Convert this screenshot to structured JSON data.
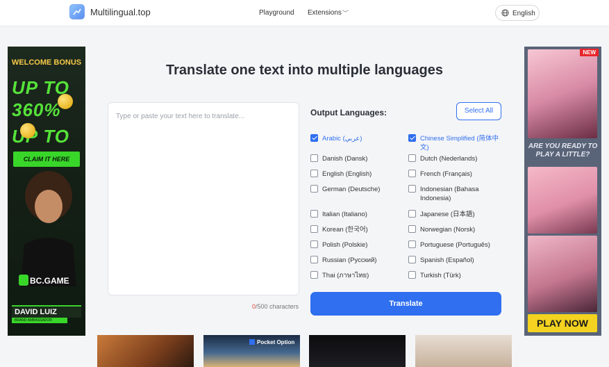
{
  "header": {
    "brand": "Multilingual.top",
    "nav": {
      "playground": "Playground",
      "extensions": "Extensions"
    },
    "language_button": "English"
  },
  "main": {
    "title": "Translate one text into multiple languages",
    "input_placeholder": "Type or paste your text here to translate...",
    "counter": {
      "count": "0",
      "suffix": "/500 characters"
    },
    "output_label": "Output Languages:",
    "select_all": "Select All",
    "translate_button": "Translate",
    "languages": [
      {
        "label": "Arabic (عربي)",
        "checked": true
      },
      {
        "label": "Chinese Simplified (简体中文)",
        "checked": true
      },
      {
        "label": "Danish (Dansk)",
        "checked": false
      },
      {
        "label": "Dutch (Nederlands)",
        "checked": false
      },
      {
        "label": "English (English)",
        "checked": false
      },
      {
        "label": "French (Français)",
        "checked": false
      },
      {
        "label": "German (Deutsche)",
        "checked": false
      },
      {
        "label": "Indonesian (Bahasa Indonesia)",
        "checked": false
      },
      {
        "label": "Italian (Italiano)",
        "checked": false
      },
      {
        "label": "Japanese (日本語)",
        "checked": false
      },
      {
        "label": "Korean (한국어)",
        "checked": false
      },
      {
        "label": "Norwegian (Norsk)",
        "checked": false
      },
      {
        "label": "Polish (Polskie)",
        "checked": false
      },
      {
        "label": "Portuguese (Português)",
        "checked": false
      },
      {
        "label": "Russian (Русский)",
        "checked": false
      },
      {
        "label": "Spanish (Español)",
        "checked": false
      },
      {
        "label": "Thai (ภาษาไทย)",
        "checked": false
      },
      {
        "label": "Turkish (Türk)",
        "checked": false
      }
    ]
  },
  "ads": {
    "left": {
      "welcome": "WELCOME BONUS",
      "upto_1": "UP TO",
      "amount": "360%",
      "upto_2": "UP TO",
      "claim": "CLAIM IT HERE",
      "brand": "BC.GAME",
      "name": "DAVID LUIZ",
      "role": "BRAND AMBASSADOR"
    },
    "right": {
      "badge": "NEW",
      "tagline": "ARE YOU READY TO PLAY A LITTLE?",
      "cta": "PLAY NOW"
    },
    "thumb_2_label": "Pocket Option"
  },
  "colors": {
    "accent": "#2f6ff0",
    "counter_zero": "#e0423a",
    "ad_green": "#39d62a",
    "ad_yellow": "#f3d320"
  }
}
